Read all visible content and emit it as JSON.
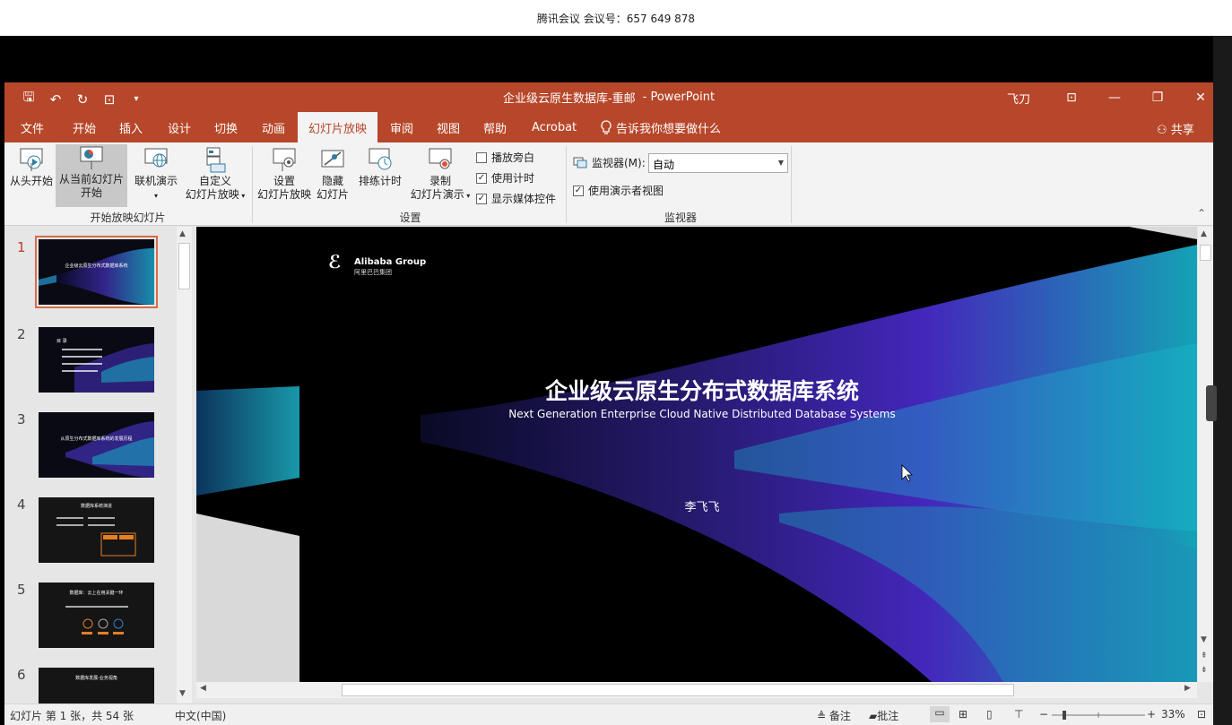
{
  "meeting": {
    "title": "腾讯会议 会议号：657 649 878"
  },
  "window": {
    "title": "企业级云原生数据库-重邮",
    "app": "PowerPoint",
    "user": "飞刀",
    "qat": {
      "save": "🖫",
      "undo": "↶",
      "redo": "↻",
      "present": "⊡",
      "customize": "▾"
    },
    "controls": {
      "ribbon_opts": "⊡",
      "minimize": "—",
      "restore": "❐",
      "close": "✕"
    }
  },
  "tabs": [
    "文件",
    "开始",
    "插入",
    "设计",
    "切换",
    "动画",
    "幻灯片放映",
    "审阅",
    "视图",
    "帮助",
    "Acrobat"
  ],
  "active_tab": "幻灯片放映",
  "tell_me": "告诉我你想要做什么",
  "share": "共享",
  "ribbon": {
    "from_start": "从头开始",
    "from_current_1": "从当前幻灯片",
    "from_current_2": "开始",
    "online_present": "联机演示",
    "custom_1": "自定义",
    "custom_2": "幻灯片放映",
    "group_start": "开始放映幻灯片",
    "setup_1": "设置",
    "setup_2": "幻灯片放映",
    "hide_1": "隐藏",
    "hide_2": "幻灯片",
    "rehearse": "排练计时",
    "record_1": "录制",
    "record_2": "幻灯片演示",
    "play_narration": "播放旁白",
    "use_timings": "使用计时",
    "show_media": "显示媒体控件",
    "group_setup": "设置",
    "monitor_label": "监视器(M):",
    "monitor_value": "自动",
    "presenter_view": "使用演示者视图",
    "group_monitor": "监视器",
    "collapse": "⌃"
  },
  "thumbnails": [
    {
      "num": "1",
      "text": "企业级云原生分布式数据库系统"
    },
    {
      "num": "2",
      "text": "目 录"
    },
    {
      "num": "3",
      "text": "从原生分布式数据库系统的发展历程"
    },
    {
      "num": "4",
      "text": "数据库系统演进"
    },
    {
      "num": "5",
      "text": "数据库：云上在用关键一环"
    },
    {
      "num": "6",
      "text": "数据库发展-业务视角"
    }
  ],
  "slide": {
    "logo": "Alibaba Group",
    "logo_cn": "阿里巴巴集团",
    "title": "企业级云原生分布式数据库系统",
    "subtitle": "Next Generation Enterprise Cloud Native Distributed Database Systems",
    "author": "李飞飞"
  },
  "status": {
    "slide_info": "幻灯片 第 1 张，共 54 张",
    "language": "中文(中国)",
    "notes": "备注",
    "comments": "批注",
    "zoom": "33%"
  }
}
